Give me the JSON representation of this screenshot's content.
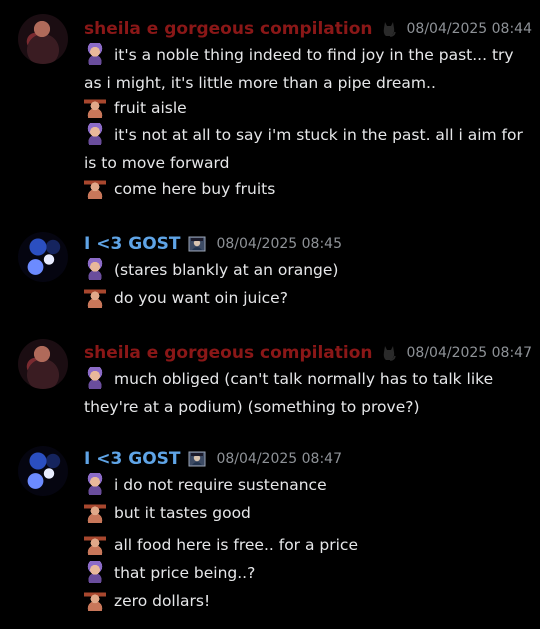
{
  "messages": [
    {
      "username": "sheila e gorgeous compilation",
      "badge_icon": "black-cat-icon",
      "timestamp": "08/04/2025 08:44",
      "lines": [
        {
          "emoji": "purple-hair-face-emoji",
          "text": "it's a noble thing indeed to find joy in the past... try as i might, it's little more than a pipe dream.."
        },
        {
          "emoji": "shopkeeper-emoji",
          "text": "fruit aisle"
        },
        {
          "emoji": "purple-hair-face-emoji",
          "text": "it's not at all to say i'm stuck in the past. all i aim for is to move forward"
        },
        {
          "emoji": "shopkeeper-emoji",
          "text": "come here buy fruits"
        }
      ]
    },
    {
      "username": "I <3 GOST",
      "badge_icon": "framed-portrait-icon",
      "timestamp": "08/04/2025 08:45",
      "lines": [
        {
          "emoji": "purple-hair-face-emoji",
          "text": "(stares blankly at an orange)"
        },
        {
          "emoji": "shopkeeper-emoji",
          "text": "do you want oin juice?"
        }
      ]
    },
    {
      "username": "sheila e gorgeous compilation",
      "badge_icon": "black-cat-icon",
      "timestamp": "08/04/2025 08:47",
      "lines": [
        {
          "emoji": "purple-hair-face-emoji",
          "text": "much obliged (can't talk normally has to talk like they're at a podium) (something to prove?)"
        }
      ]
    },
    {
      "username": "I <3 GOST",
      "badge_icon": "framed-portrait-icon",
      "timestamp": "08/04/2025 08:47",
      "lines": [
        {
          "emoji": "purple-hair-face-emoji",
          "text": "i do not require sustenance"
        },
        {
          "emoji": "shopkeeper-emoji",
          "text": "but it tastes good"
        },
        {
          "emoji": "shopkeeper-emoji",
          "text": "all food here is free.. for a price"
        },
        {
          "emoji": "purple-hair-face-emoji",
          "text": "that price being..?"
        },
        {
          "emoji": "shopkeeper-emoji",
          "text": "zero dollars!"
        }
      ]
    }
  ],
  "colors": {
    "background": "#000000",
    "sheila_name": "#8a1717",
    "gost_name": "#5fa4e6",
    "timestamp": "#8e9297",
    "text": "#e6e7e9"
  }
}
